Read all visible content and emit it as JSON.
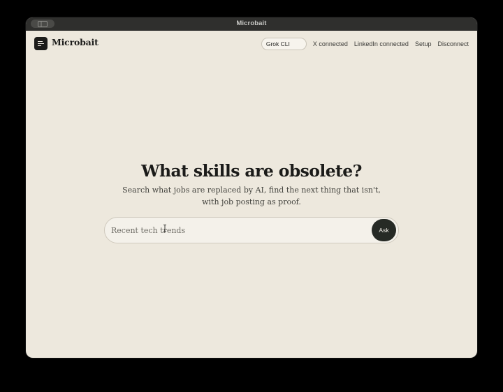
{
  "window": {
    "title": "Microbait"
  },
  "header": {
    "app_name": "Microbait",
    "provider_select": "Grok CLI",
    "nav": {
      "x_status": "X connected",
      "linkedin_status": "LinkedIn connected",
      "setup": "Setup",
      "disconnect": "Disconnect"
    }
  },
  "hero": {
    "title": "What skills are obsolete?",
    "subtitle": "Search what jobs are replaced by AI, find the next thing that isn't, with job posting as proof."
  },
  "search": {
    "placeholder": "Recent tech trends",
    "value": "",
    "button_label": "Ask"
  },
  "icons": {
    "logo": "menu-lines-icon",
    "sidebar_toggle": "sidebar-toggle-icon",
    "cursor": "text-cursor-icon"
  },
  "colors": {
    "background": "#ede8dd",
    "titlebar": "#2f2f2d",
    "accent_button": "#262a25",
    "text_primary": "#1b1b19"
  }
}
